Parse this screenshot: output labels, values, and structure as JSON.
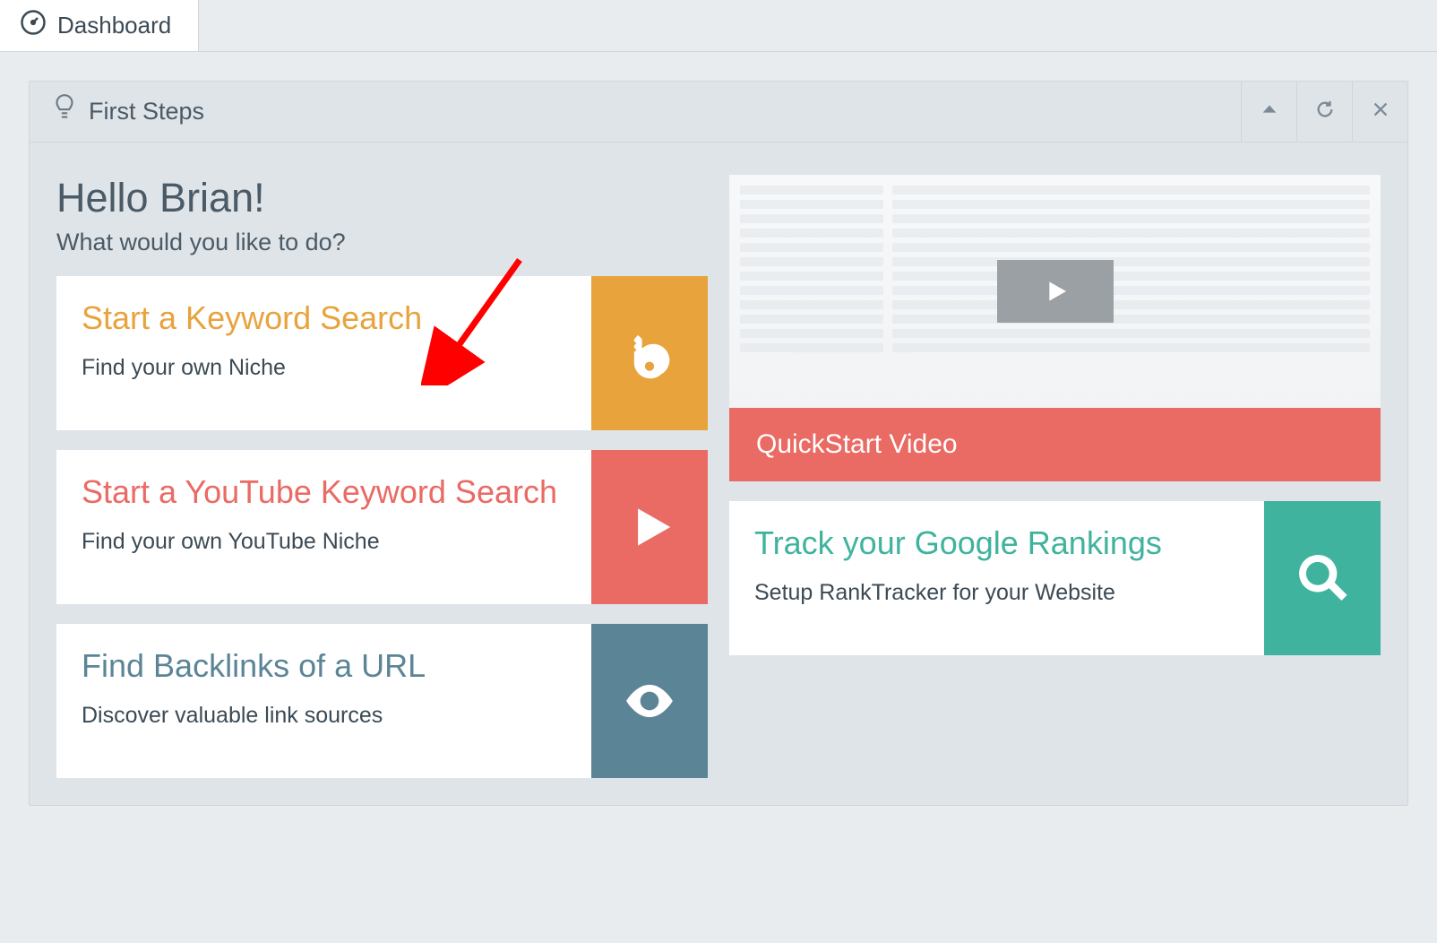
{
  "tab": {
    "label": "Dashboard"
  },
  "panel": {
    "title": "First Steps"
  },
  "greeting": {
    "hello": "Hello Brian!",
    "subtitle": "What would you like to do?"
  },
  "tiles": {
    "keyword": {
      "title": "Start a Keyword Search",
      "subtitle": "Find your own Niche"
    },
    "youtube": {
      "title": "Start a YouTube Keyword Search",
      "subtitle": "Find your own YouTube Niche"
    },
    "backlinks": {
      "title": "Find Backlinks of a URL",
      "subtitle": "Discover valuable link sources"
    },
    "ranktracker": {
      "title": "Track your Google Rankings",
      "subtitle": "Setup RankTracker for your Website"
    }
  },
  "video": {
    "label": "QuickStart Video"
  }
}
